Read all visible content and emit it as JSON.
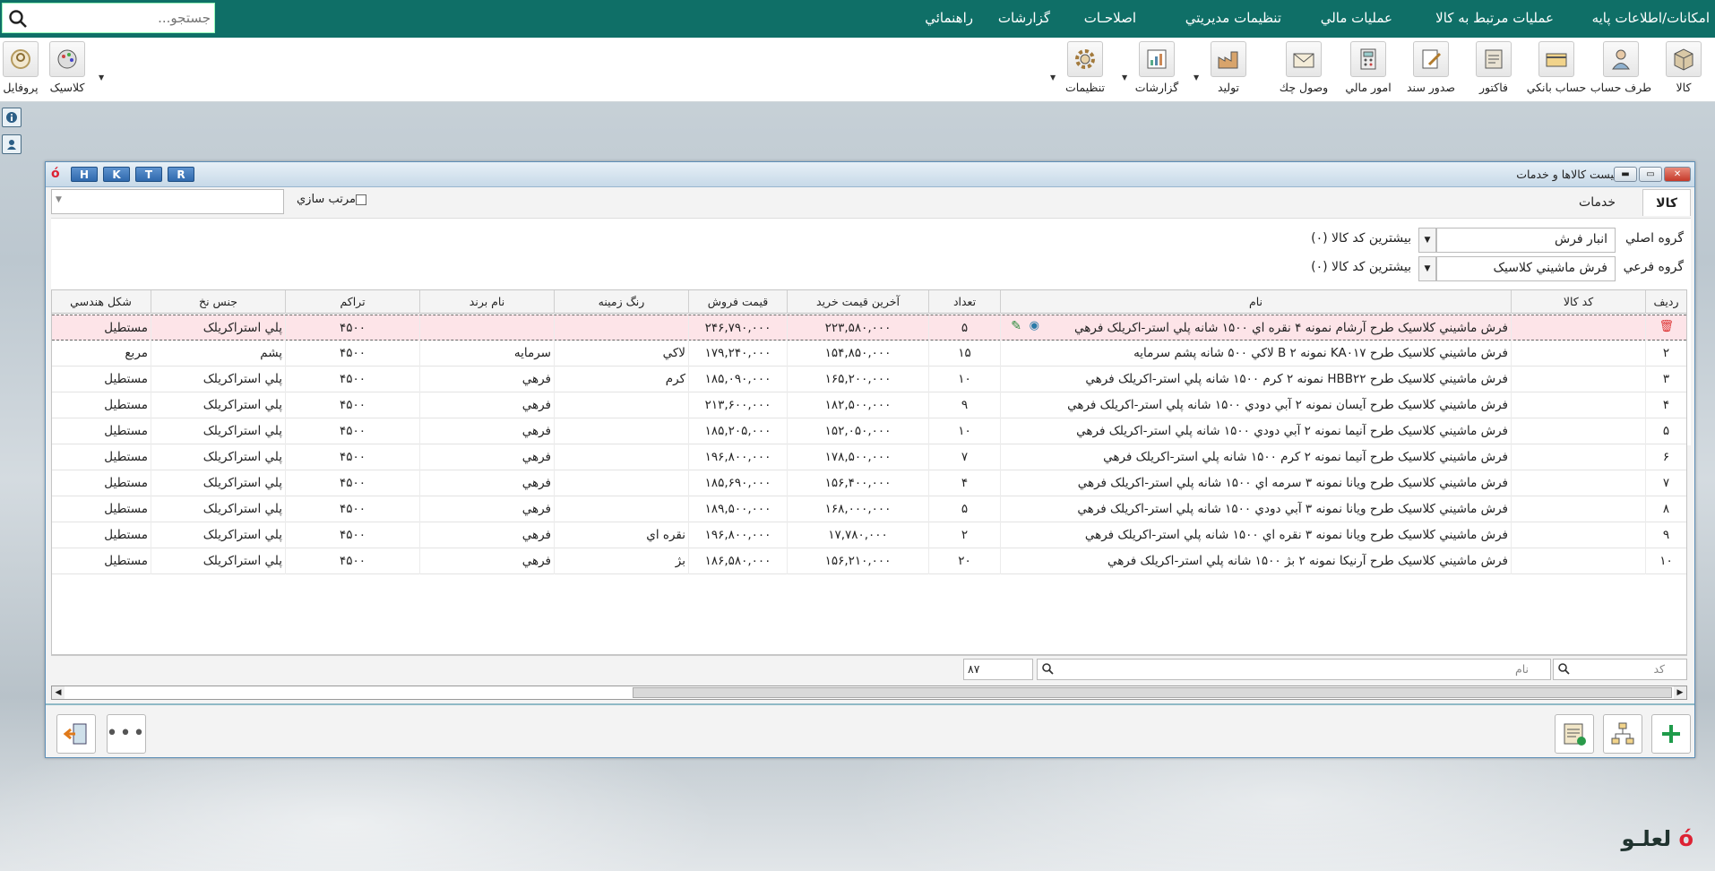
{
  "menu": {
    "items": [
      "امکانات/اطلاعات پايه",
      "عمليات مرتبط به کالا",
      "عمليات مالي",
      "تنظيمات مديريتي",
      "اصلاحـات",
      "گزارشات",
      "راهنمائي"
    ],
    "search_placeholder": "جستجو..."
  },
  "toolbar": {
    "right": [
      "کالا",
      "طرف حساب",
      "حساب بانکي",
      "فاکتور",
      "صدور سند",
      "امور مالي",
      "وصول چك",
      "توليد",
      "گزارشات",
      "تنظيمات"
    ],
    "left": [
      "كلاسيک",
      "پروفايل"
    ]
  },
  "window": {
    "title": "ليست کالاها و خدمات",
    "hotkeys": [
      "H",
      "K",
      "T",
      "R"
    ],
    "tabs": [
      "کالا",
      "خدمات"
    ],
    "sort_label": "مرتب سازي"
  },
  "filters": {
    "main_group_label": "گروه اصلي",
    "main_group_value": "انبار فرش",
    "main_group_hint": "بيشترين کد کالا (۰)",
    "sub_group_label": "گروه فرعي",
    "sub_group_value": "فرش ماشيني كلاسيک",
    "sub_group_hint": "بيشترين کد کالا (۰)"
  },
  "grid": {
    "headers": [
      "رديف",
      "کد کالا",
      "نام",
      "تعداد",
      "آخرين قيمت خريد",
      "قيمت فروش",
      "رنگ زمينه",
      "نام برند",
      "تراکم",
      "جنس نخ",
      "شکل هندسي"
    ],
    "rows": [
      [
        "",
        "",
        "فرش ماشيني كلاسيک طرح آرشام نمونه ۴ نقره اي ۱۵۰۰ شانه پلي استر-اکريلک فرهي",
        "۵",
        "۲۲۳,۵۸۰,۰۰۰",
        "۲۴۶,۷۹۰,۰۰۰",
        "",
        "",
        "۴۵۰۰",
        "پلي استراکريلک",
        "مستطيل"
      ],
      [
        "۲",
        "",
        "فرش ماشيني كلاسيک طرح KA۰۱۷ نمونه B ۲ لاکي ۵۰۰ شانه پشم سرمايه",
        "۱۵",
        "۱۵۴,۸۵۰,۰۰۰",
        "۱۷۹,۲۴۰,۰۰۰",
        "لاکي",
        "سرمايه",
        "۴۵۰۰",
        "پشم",
        "مربع"
      ],
      [
        "۳",
        "",
        "فرش ماشيني كلاسيک طرح HBB۲۲ نمونه ۲ کرم ۱۵۰۰ شانه پلي استر-اکريلک فرهي",
        "۱۰",
        "۱۶۵,۲۰۰,۰۰۰",
        "۱۸۵,۰۹۰,۰۰۰",
        "کرم",
        "فرهي",
        "۴۵۰۰",
        "پلي استراکريلک",
        "مستطيل"
      ],
      [
        "۴",
        "",
        "فرش ماشيني كلاسيک طرح آيسان نمونه ۲ آبي دودي ۱۵۰۰ شانه پلي استر-اکريلک فرهي",
        "۹",
        "۱۸۲,۵۰۰,۰۰۰",
        "۲۱۳,۶۰۰,۰۰۰",
        "",
        "فرهي",
        "۴۵۰۰",
        "پلي استراکريلک",
        "مستطيل"
      ],
      [
        "۵",
        "",
        "فرش ماشيني كلاسيک طرح آنيما نمونه ۲ آبي دودي ۱۵۰۰ شانه پلي استر-اکريلک فرهي",
        "۱۰",
        "۱۵۲,۰۵۰,۰۰۰",
        "۱۸۵,۲۰۵,۰۰۰",
        "",
        "فرهي",
        "۴۵۰۰",
        "پلي استراکريلک",
        "مستطيل"
      ],
      [
        "۶",
        "",
        "فرش ماشيني كلاسيک طرح آنيما نمونه ۲ کرم ۱۵۰۰ شانه پلي استر-اکريلک فرهي",
        "۷",
        "۱۷۸,۵۰۰,۰۰۰",
        "۱۹۶,۸۰۰,۰۰۰",
        "",
        "فرهي",
        "۴۵۰۰",
        "پلي استراکريلک",
        "مستطيل"
      ],
      [
        "۷",
        "",
        "فرش ماشيني كلاسيک طرح ويانا نمونه ۳ سرمه اي ۱۵۰۰ شانه پلي استر-اکريلک فرهي",
        "۴",
        "۱۵۶,۴۰۰,۰۰۰",
        "۱۸۵,۶۹۰,۰۰۰",
        "",
        "فرهي",
        "۴۵۰۰",
        "پلي استراکريلک",
        "مستطيل"
      ],
      [
        "۸",
        "",
        "فرش ماشيني كلاسيک طرح ويانا نمونه ۳ آبي دودي ۱۵۰۰ شانه پلي استر-اکريلک فرهي",
        "۵",
        "۱۶۸,۰۰۰,۰۰۰",
        "۱۸۹,۵۰۰,۰۰۰",
        "",
        "فرهي",
        "۴۵۰۰",
        "پلي استراکريلک",
        "مستطيل"
      ],
      [
        "۹",
        "",
        "فرش ماشيني كلاسيک طرح ويانا نمونه ۳ نقره اي ۱۵۰۰ شانه پلي استر-اکريلک فرهي",
        "۲",
        "۱۷,۷۸۰,۰۰۰",
        "۱۹۶,۸۰۰,۰۰۰",
        "نقره اي",
        "فرهي",
        "۴۵۰۰",
        "پلي استراکريلک",
        "مستطيل"
      ],
      [
        "۱۰",
        "",
        "فرش ماشيني كلاسيک طرح آرنيکا نمونه ۲ بژ ۱۵۰۰ شانه پلي استر-اکريلک فرهي",
        "۲۰",
        "۱۵۶,۲۱۰,۰۰۰",
        "۱۸۶,۵۸۰,۰۰۰",
        "بژ",
        "فرهي",
        "۴۵۰۰",
        "پلي استراکريلک",
        "مستطيل"
      ]
    ]
  },
  "filter_row": {
    "code_placeholder": "کد",
    "name_placeholder": "نام",
    "count": "۸۷"
  },
  "brand": "لعلـو",
  "colors": {
    "menu_bg": "#0f6f67",
    "selected_row": "#fde4e8",
    "add_green": "#1e9b4a"
  }
}
